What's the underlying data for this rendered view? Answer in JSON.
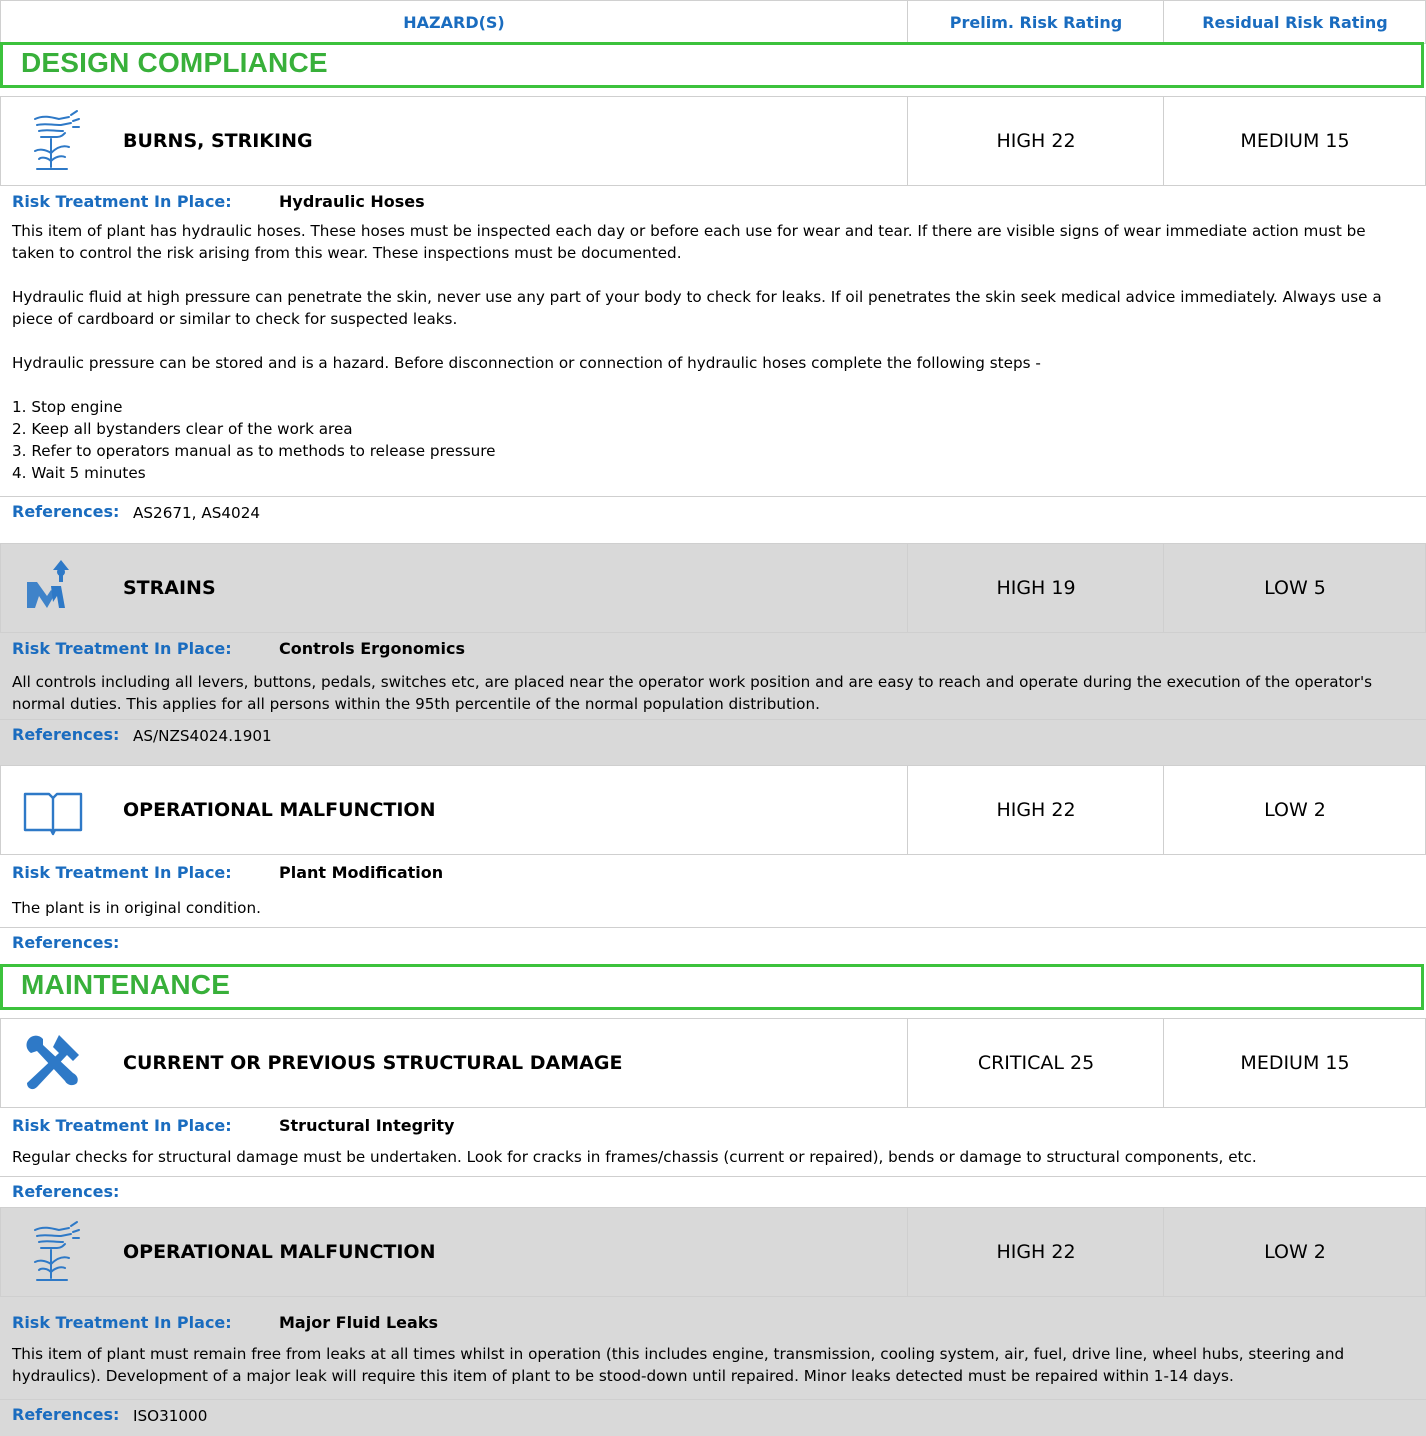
{
  "header": {
    "hazards": "HAZARD(S)",
    "prelim": "Prelim. Risk Rating",
    "residual": "Residual Risk Rating"
  },
  "sections": [
    {
      "title": "DESIGN COMPLIANCE",
      "hazards": [
        {
          "icon": "hand-spray-icon",
          "name": "BURNS, STRIKING",
          "prelim": "HIGH 22",
          "residual": "MEDIUM 15",
          "treatment_label": "Risk Treatment In Place:",
          "treatment": "Hydraulic Hoses",
          "paragraphs": [
            "This item of plant has hydraulic hoses. These hoses must be inspected each day or before each use for wear and tear. If there are visible signs of wear immediate action must be taken to control the risk arising from this wear. These inspections must be documented.",
            "Hydraulic fluid at high pressure can penetrate the skin, never use any part of your body to check for leaks. If oil penetrates the skin seek medical advice immediately. Always use a piece of cardboard or similar to check for suspected leaks.",
            "Hydraulic pressure can be stored and is a hazard. Before disconnection or connection of hydraulic hoses complete the following steps -",
            "1. Stop engine",
            "2. Keep all bystanders clear of the work area",
            "3. Refer to operators manual as to methods to release pressure",
            "4. Wait 5 minutes"
          ],
          "references_label": "References:",
          "references": "AS2671, AS4024"
        },
        {
          "icon": "worker-strain-icon",
          "name": "STRAINS",
          "prelim": "HIGH 19",
          "residual": "LOW 5",
          "treatment_label": "Risk Treatment In Place:",
          "treatment": "Controls Ergonomics",
          "paragraphs": [
            "All controls including all levers, buttons, pedals, switches etc, are placed near the operator work position and are easy to reach and operate during the execution of the operator's normal duties. This applies for all persons within the 95th percentile of the normal population distribution."
          ],
          "references_label": "References:",
          "references": "AS/NZS4024.1901"
        },
        {
          "icon": "open-book-icon",
          "name": "OPERATIONAL MALFUNCTION",
          "prelim": "HIGH 22",
          "residual": "LOW 2",
          "treatment_label": "Risk Treatment In Place:",
          "treatment": "Plant Modification",
          "paragraphs": [
            "The plant is in original condition."
          ],
          "references_label": "References:",
          "references": ""
        }
      ]
    },
    {
      "title": "MAINTENANCE",
      "hazards": [
        {
          "icon": "wrench-hammer-icon",
          "name": "CURRENT OR PREVIOUS STRUCTURAL DAMAGE",
          "prelim": "CRITICAL 25",
          "residual": "MEDIUM 15",
          "treatment_label": "Risk Treatment In Place:",
          "treatment": "Structural Integrity",
          "paragraphs": [
            "Regular checks for structural damage must be undertaken. Look for cracks in frames/chassis (current or repaired), bends or damage to structural components, etc."
          ],
          "references_label": "References:",
          "references": ""
        },
        {
          "icon": "hand-spray-icon",
          "name": "OPERATIONAL MALFUNCTION",
          "prelim": "HIGH 22",
          "residual": "LOW 2",
          "treatment_label": "Risk Treatment In Place:",
          "treatment": "Major Fluid Leaks",
          "paragraphs": [
            "This item of plant must remain free from leaks at all times whilst in operation (this includes engine, transmission, cooling system, air, fuel, drive line, wheel hubs, steering and hydraulics). Development of a major leak will require this item of plant to be stood-down until repaired. Minor leaks detected must be repaired within 1-14 days."
          ],
          "references_label": "References:",
          "references": "ISO31000"
        }
      ]
    }
  ]
}
